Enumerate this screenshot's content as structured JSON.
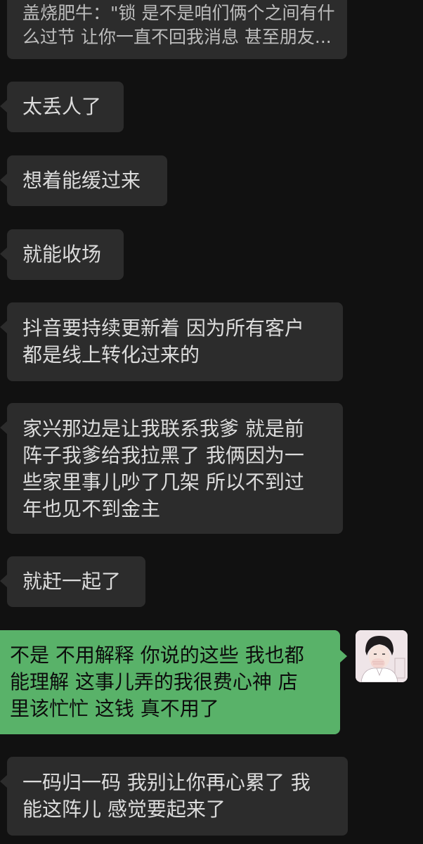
{
  "chat": {
    "messages": [
      {
        "side": "in",
        "lines": [
          "盖烧肥牛：\"锁 是不是咱们俩个之间有什",
          "么过节 让你一直不回我消息 甚至朋友..."
        ]
      },
      {
        "side": "in",
        "lines": [
          "太丢人了"
        ]
      },
      {
        "side": "in",
        "lines": [
          "想着能缓过来"
        ]
      },
      {
        "side": "in",
        "lines": [
          "就能收场"
        ]
      },
      {
        "side": "in",
        "lines": [
          "抖音要持续更新着 因为所有客户",
          "都是线上转化过来的"
        ]
      },
      {
        "side": "in",
        "lines": [
          "家兴那边是让我联系我爹 就是前",
          "阵子我爹给我拉黑了 我俩因为一",
          "些家里事儿吵了几架 所以不到过",
          "年也见不到金主"
        ]
      },
      {
        "side": "in",
        "lines": [
          "就赶一起了"
        ]
      },
      {
        "side": "out",
        "lines": [
          "不是 不用解释 你说的这些 我也都",
          "能理解 这事儿弄的我很费心神  店",
          "里该忙忙 这钱 真不用了"
        ]
      },
      {
        "side": "in",
        "lines": [
          "一码归一码 我别让你再心累了 我",
          "能这阵儿 感觉要起来了"
        ]
      }
    ]
  },
  "colors": {
    "background": "#111111",
    "incoming_bubble": "#2c2c2c",
    "outgoing_bubble": "#59b269",
    "incoming_text": "#dcdcdc",
    "outgoing_text": "#0c0c0c"
  },
  "icons": {
    "self_avatar": "cartoon-boy-avatar"
  }
}
